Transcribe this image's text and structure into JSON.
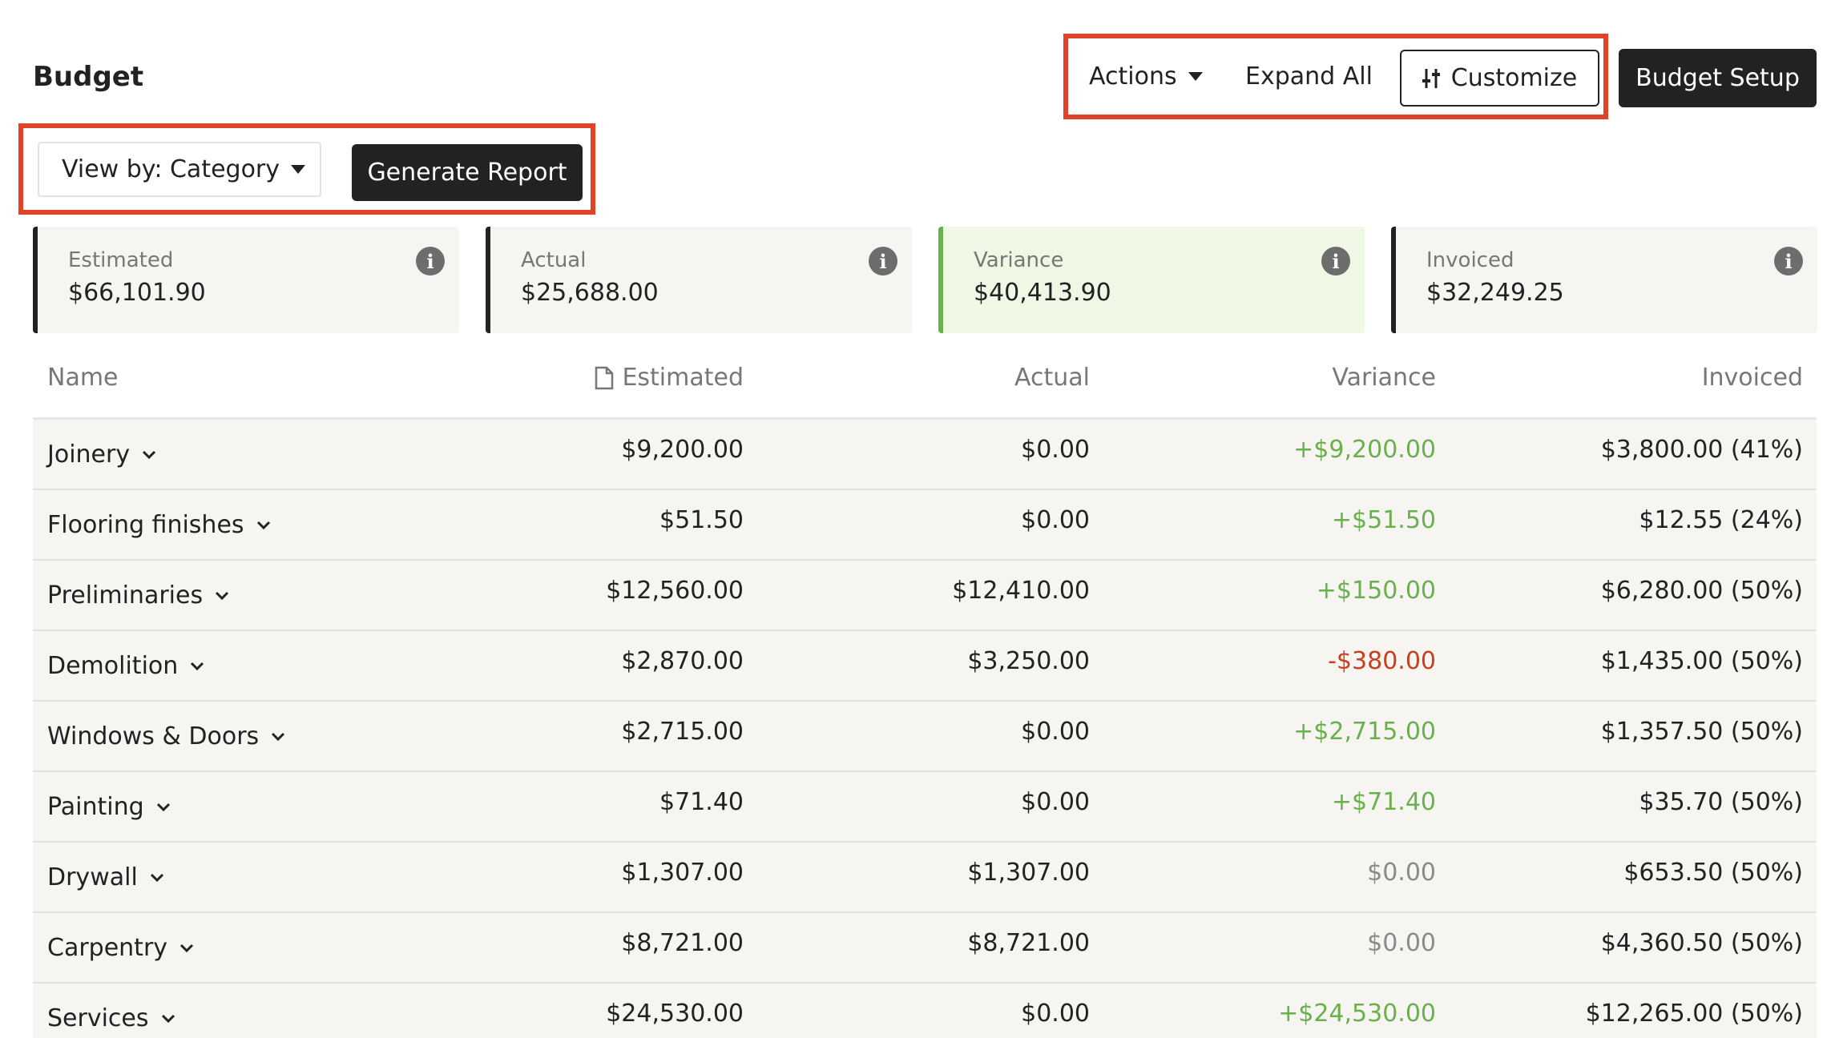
{
  "header": {
    "title": "Budget",
    "actions_label": "Actions",
    "expand_all_label": "Expand All",
    "customize_label": "Customize",
    "budget_setup_label": "Budget Setup"
  },
  "report": {
    "view_by_label": "View by: Category",
    "generate_label": "Generate Report"
  },
  "summary": {
    "estimated": {
      "label": "Estimated",
      "value": "$66,101.90"
    },
    "actual": {
      "label": "Actual",
      "value": "$25,688.00"
    },
    "variance": {
      "label": "Variance",
      "value": "$40,413.90"
    },
    "invoiced": {
      "label": "Invoiced",
      "value": "$32,249.25"
    }
  },
  "table": {
    "columns": [
      "Name",
      "Estimated",
      "Actual",
      "Variance",
      "Invoiced"
    ],
    "rows": [
      {
        "name": "Joinery",
        "estimated": "$9,200.00",
        "actual": "$0.00",
        "variance": "+$9,200.00",
        "variance_status": "pos",
        "invoiced": "$3,800.00 (41%)"
      },
      {
        "name": "Flooring finishes",
        "estimated": "$51.50",
        "actual": "$0.00",
        "variance": "+$51.50",
        "variance_status": "pos",
        "invoiced": "$12.55 (24%)"
      },
      {
        "name": "Preliminaries",
        "estimated": "$12,560.00",
        "actual": "$12,410.00",
        "variance": "+$150.00",
        "variance_status": "pos",
        "invoiced": "$6,280.00 (50%)"
      },
      {
        "name": "Demolition",
        "estimated": "$2,870.00",
        "actual": "$3,250.00",
        "variance": "-$380.00",
        "variance_status": "neg",
        "invoiced": "$1,435.00 (50%)"
      },
      {
        "name": "Windows & Doors",
        "estimated": "$2,715.00",
        "actual": "$0.00",
        "variance": "+$2,715.00",
        "variance_status": "pos",
        "invoiced": "$1,357.50 (50%)"
      },
      {
        "name": "Painting",
        "estimated": "$71.40",
        "actual": "$0.00",
        "variance": "+$71.40",
        "variance_status": "pos",
        "invoiced": "$35.70 (50%)"
      },
      {
        "name": "Drywall",
        "estimated": "$1,307.00",
        "actual": "$1,307.00",
        "variance": "$0.00",
        "variance_status": "zero",
        "invoiced": "$653.50 (50%)"
      },
      {
        "name": "Carpentry",
        "estimated": "$8,721.00",
        "actual": "$8,721.00",
        "variance": "$0.00",
        "variance_status": "zero",
        "invoiced": "$4,360.50 (50%)"
      },
      {
        "name": "Services",
        "estimated": "$24,530.00",
        "actual": "$0.00",
        "variance": "+$24,530.00",
        "variance_status": "pos",
        "invoiced": "$12,265.00 (50%)"
      }
    ]
  },
  "colors": {
    "accent_dark": "#222222",
    "highlight_border": "#e0422a",
    "positive": "#6ab04c",
    "negative": "#c9401f"
  }
}
